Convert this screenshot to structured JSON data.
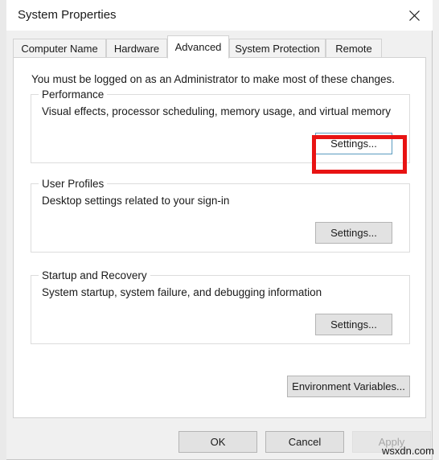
{
  "window": {
    "title": "System Properties",
    "close_icon": "close-icon"
  },
  "tabs": [
    {
      "label": "Computer Name",
      "selected": false
    },
    {
      "label": "Hardware",
      "selected": false
    },
    {
      "label": "Advanced",
      "selected": true
    },
    {
      "label": "System Protection",
      "selected": false
    },
    {
      "label": "Remote",
      "selected": false
    }
  ],
  "advanced": {
    "admin_note": "You must be logged on as an Administrator to make most of these changes.",
    "groups": [
      {
        "title": "Performance",
        "description": "Visual effects, processor scheduling, memory usage, and virtual memory",
        "button_label": "Settings...",
        "button_state": "hover",
        "highlighted": true
      },
      {
        "title": "User Profiles",
        "description": "Desktop settings related to your sign-in",
        "button_label": "Settings...",
        "button_state": "normal",
        "highlighted": false
      },
      {
        "title": "Startup and Recovery",
        "description": "System startup, system failure, and debugging information",
        "button_label": "Settings...",
        "button_state": "normal",
        "highlighted": false
      }
    ],
    "environment_variables_label": "Environment Variables..."
  },
  "footer": {
    "ok_label": "OK",
    "cancel_label": "Cancel",
    "apply_label": "Apply",
    "apply_disabled": true
  },
  "watermark": "wsxdn.com",
  "colors": {
    "annotation": "#e81313",
    "hover_border": "#5a9bbf",
    "dialog_bg": "#f0f0f0",
    "panel_bg": "#ffffff"
  }
}
